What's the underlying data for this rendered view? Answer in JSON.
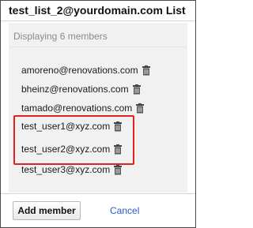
{
  "dialog": {
    "title": "test_list_2@yourdomain.com List",
    "member_count_text": "Displaying 6 members"
  },
  "members": [
    {
      "email": "amoreno@renovations.com"
    },
    {
      "email": "bheinz@renovations.com"
    },
    {
      "email": "tamado@renovations.com"
    },
    {
      "email": "test_user1@xyz.com"
    },
    {
      "email": "test_user2@xyz.com"
    },
    {
      "email": "test_user3@xyz.com"
    }
  ],
  "footer": {
    "add_member_label": "Add member",
    "cancel_label": "Cancel"
  },
  "colors": {
    "highlight": "#e3211f",
    "link": "#2b57c5"
  },
  "icons": {
    "delete": "trash-icon"
  }
}
